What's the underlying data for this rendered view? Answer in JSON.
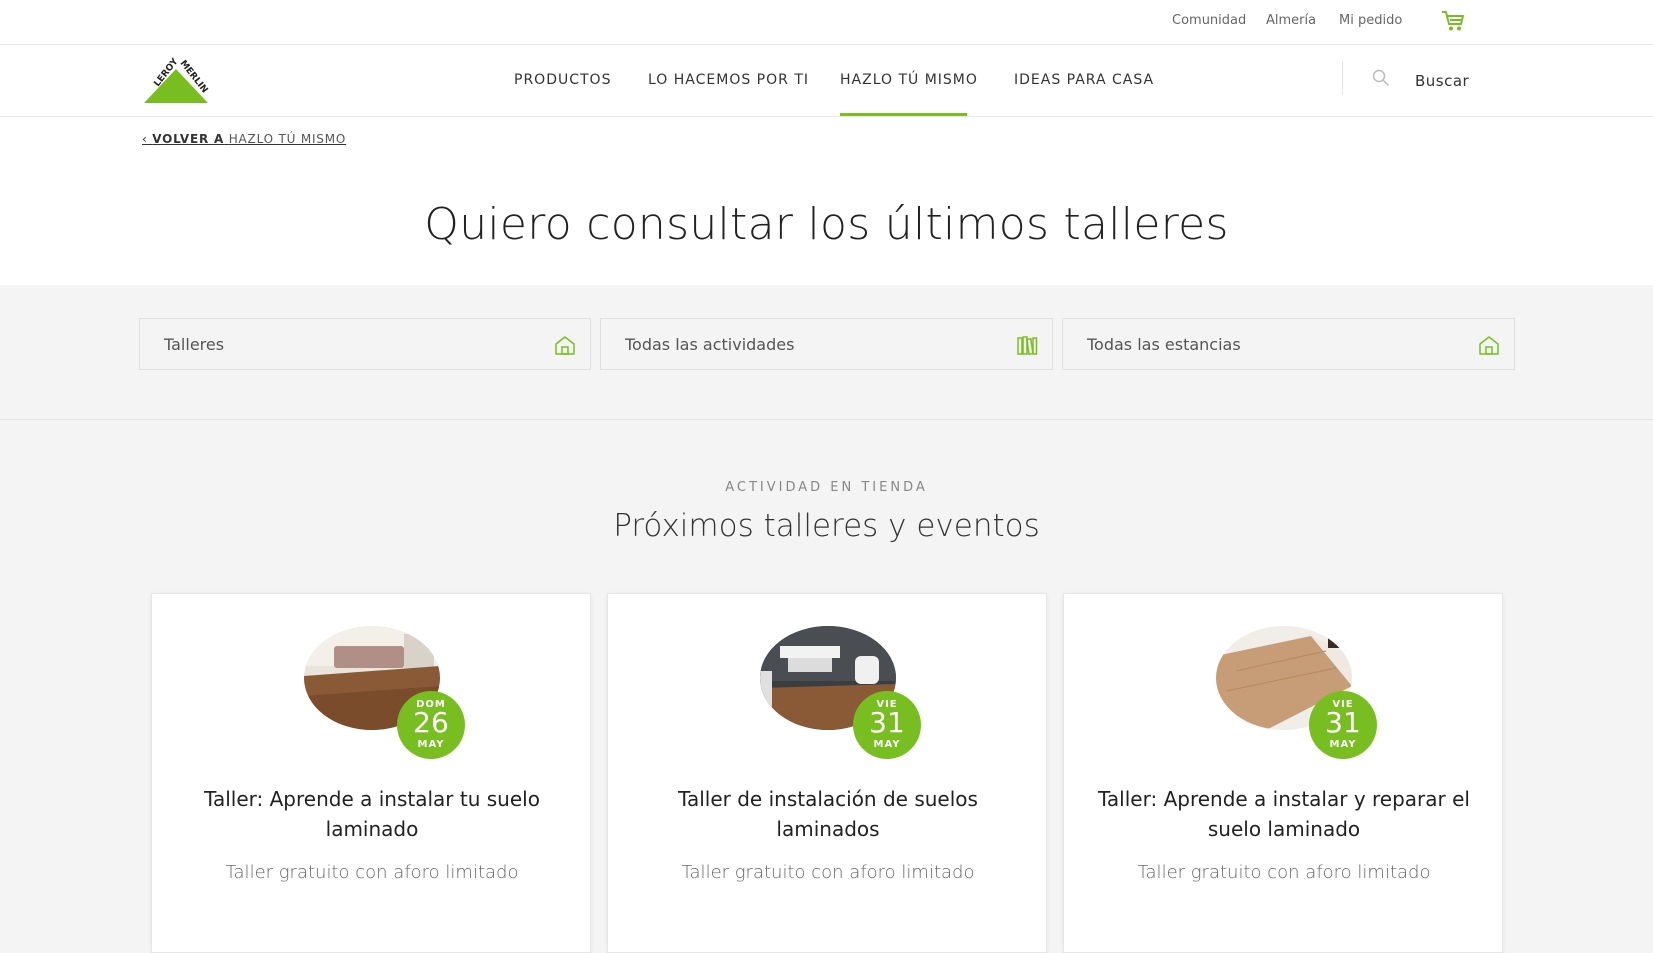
{
  "utility": {
    "links": [
      "Comunidad",
      "Almería",
      "Mi pedido"
    ]
  },
  "logo": {
    "line1": "LEROY",
    "line2": "MERLIN"
  },
  "nav": {
    "items": [
      "PRODUCTOS",
      "LO HACEMOS POR TI",
      "HAZLO TÚ MISMO",
      "IDEAS PARA CASA"
    ],
    "active": "HAZLO TÚ MISMO",
    "search_label": "Buscar"
  },
  "breadcrumb": {
    "prefix": "VOLVER A",
    "target": "HAZLO TÚ MISMO"
  },
  "hero": {
    "title": "Quiero consultar los últimos talleres"
  },
  "filters": [
    {
      "label": "Talleres",
      "icon": "house-icon"
    },
    {
      "label": "Todas las actividades",
      "icon": "books-icon"
    },
    {
      "label": "Todas las estancias",
      "icon": "house-icon"
    }
  ],
  "events": {
    "eyebrow": "ACTIVIDAD EN TIENDA",
    "title": "Próximos talleres y eventos",
    "cards": [
      {
        "dow": "DOM",
        "day": "26",
        "month": "MAY",
        "title": "Taller: Aprende a instalar tu suelo laminado",
        "subtitle": "Taller gratuito con aforo limitado"
      },
      {
        "dow": "VIE",
        "day": "31",
        "month": "MAY",
        "title": "Taller de instalación de suelos laminados",
        "subtitle": "Taller gratuito con aforo limitado"
      },
      {
        "dow": "VIE",
        "day": "31",
        "month": "MAY",
        "title": "Taller: Aprende a instalar y reparar el suelo laminado",
        "subtitle": "Taller gratuito con aforo limitado"
      }
    ]
  },
  "colors": {
    "brand_green": "#78be20",
    "text_dark": "#222222",
    "text_muted": "#666666",
    "page_bg": "#f4f4f4"
  }
}
